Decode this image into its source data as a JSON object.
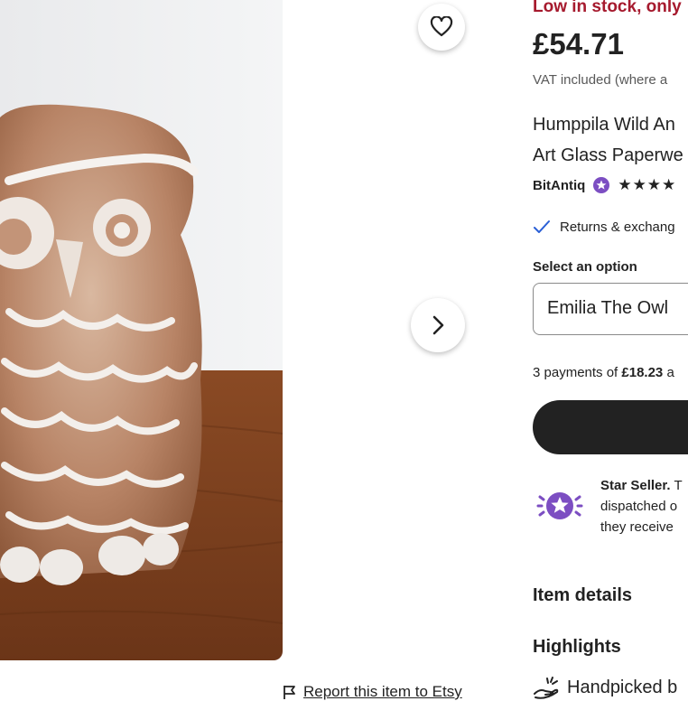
{
  "stock_text": "Low in stock, only",
  "price": "£54.71",
  "vat_text": "VAT included (where a",
  "title_line1": "Humppila Wild An",
  "title_line2": "Art Glass Paperwe",
  "shop_name": "BitAntiq",
  "rating_stars": "★★★★",
  "returns_text": "Returns & exchang",
  "select_label": "Select an option",
  "select_value": "Emilia The Owl",
  "payments": {
    "prefix": "3 payments of ",
    "amount": "£18.23",
    "suffix": " a"
  },
  "star_seller": {
    "bold": "Star Seller.",
    "line1_rest": " T",
    "line2": "dispatched o",
    "line3": "they receive"
  },
  "item_details": "Item details",
  "highlights": "Highlights",
  "handpicked_text": "Handpicked b",
  "report_text": "Report this item to Etsy",
  "icons": {
    "favorite": "heart-icon",
    "next": "chevron-right-icon",
    "flag": "flag-icon",
    "check": "check-icon",
    "star_badge": "star-seller-badge-icon",
    "hand": "hand-icon"
  },
  "colors": {
    "stock_red": "#a61a2e",
    "check_blue": "#2a5fd6",
    "badge_purple": "#7c4ec2",
    "button_dark": "#222222"
  }
}
